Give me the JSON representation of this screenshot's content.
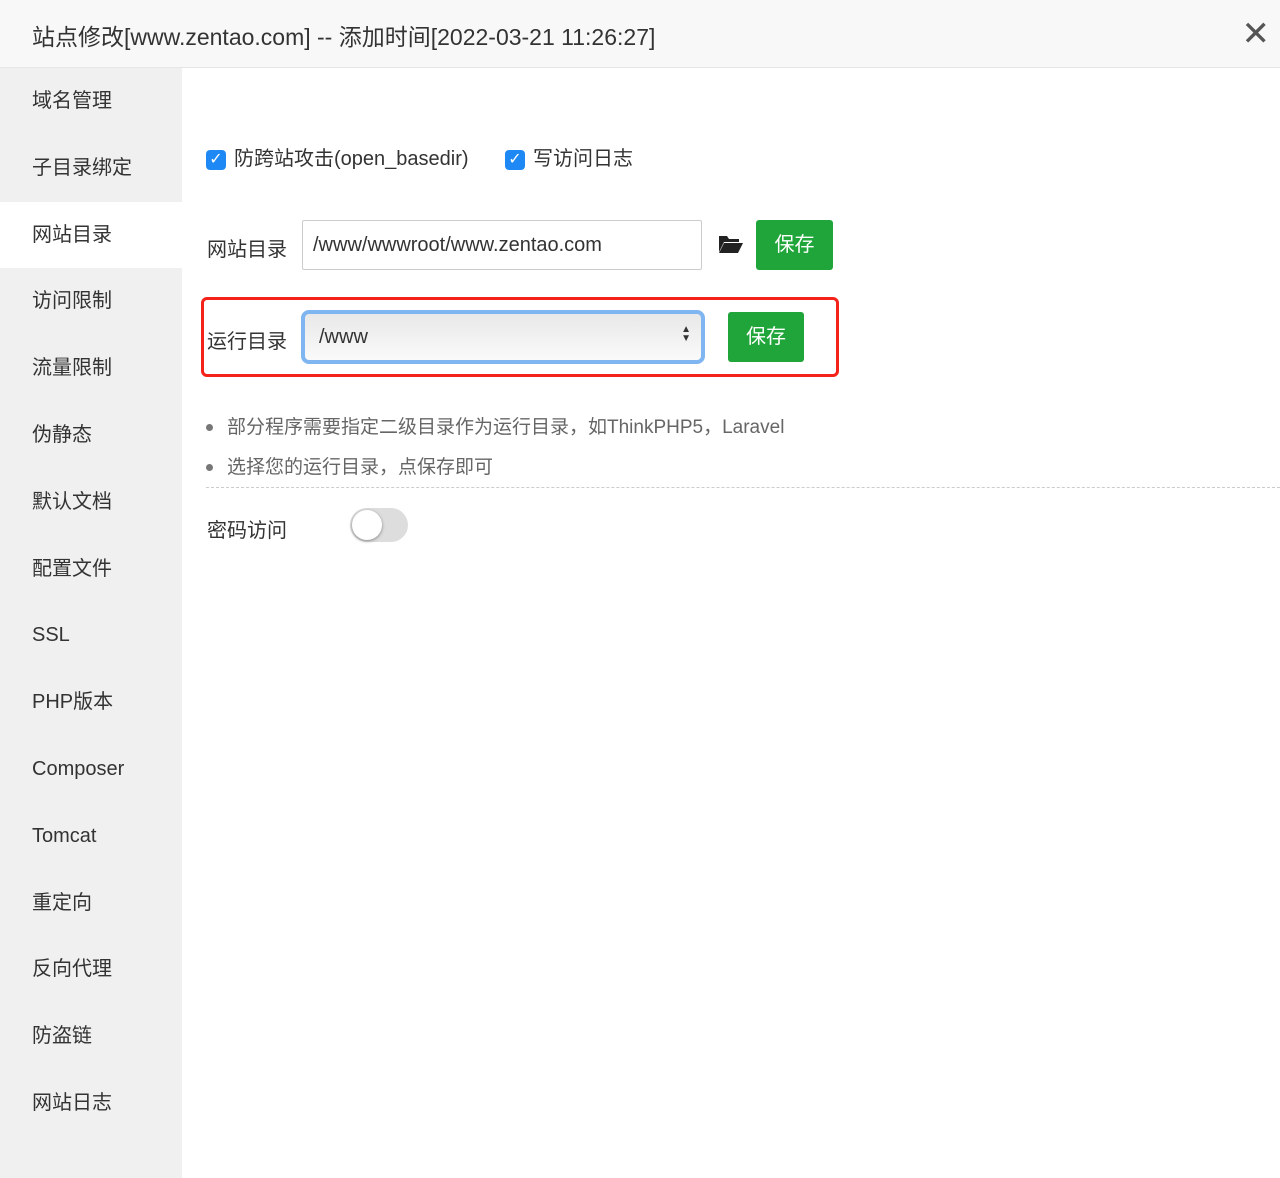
{
  "header": {
    "title": "站点修改[www.zentao.com] -- 添加时间[2022-03-21 11:26:27]",
    "close_icon": "close-icon"
  },
  "sidebar": {
    "active": "网站目录",
    "items": [
      "域名管理",
      "子目录绑定",
      "网站目录",
      "访问限制",
      "流量限制",
      "伪静态",
      "默认文档",
      "配置文件",
      "SSL",
      "PHP版本",
      "Composer",
      "Tomcat",
      "重定向",
      "反向代理",
      "防盗链",
      "网站日志"
    ]
  },
  "main": {
    "checkboxes": [
      {
        "label": "防跨站攻击(open_basedir)",
        "checked": true
      },
      {
        "label": "写访问日志",
        "checked": true
      }
    ],
    "site_dir": {
      "label": "网站目录",
      "value": "/www/wwwroot/www.zentao.com",
      "save": "保存"
    },
    "run_dir": {
      "label": "运行目录",
      "value": "/www",
      "save": "保存"
    },
    "tips": [
      "部分程序需要指定二级目录作为运行目录，如ThinkPHP5，Laravel",
      "选择您的运行目录，点保存即可"
    ],
    "password_access": {
      "label": "密码访问",
      "enabled": false
    }
  },
  "colors": {
    "accent": "#20a53a",
    "highlight": "#f5221a",
    "focus": "#7fb5f0"
  }
}
